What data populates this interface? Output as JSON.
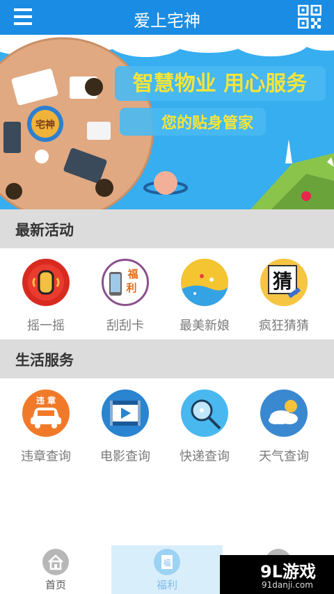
{
  "app": {
    "title": "爱上宅神"
  },
  "banner": {
    "headline": "智慧物业  用心服务",
    "subline": "您的贴身管家",
    "mascot": "宅神"
  },
  "sections": {
    "activities": {
      "title": "最新活动",
      "items": [
        {
          "label": "摇一摇",
          "icon": "shake-hand-icon"
        },
        {
          "label": "刮刮卡",
          "icon": "scratch-card-icon",
          "badge_top": "福",
          "badge_bottom": "利"
        },
        {
          "label": "最美新娘",
          "icon": "beach-icon"
        },
        {
          "label": "疯狂猜猜",
          "icon": "guess-icon",
          "badge": "猜"
        }
      ]
    },
    "services": {
      "title": "生活服务",
      "items": [
        {
          "label": "违章查询",
          "icon": "car-violation-icon",
          "badge": "违 章"
        },
        {
          "label": "电影查询",
          "icon": "film-icon"
        },
        {
          "label": "快递查询",
          "icon": "magnifier-icon"
        },
        {
          "label": "天气查询",
          "icon": "weather-icon"
        }
      ]
    }
  },
  "bottom_nav": {
    "tabs": [
      {
        "label": "首页",
        "icon": "home-icon"
      },
      {
        "label": "福利",
        "icon": "gift-icon",
        "glyph": "福"
      }
    ]
  },
  "watermark": {
    "main": "9L游戏",
    "sub": "91danji.com"
  },
  "colors": {
    "primary": "#1a8ce3",
    "banner_bg": "#36aef0",
    "section_bg": "#dcdcdc",
    "headline_text": "#f5e53a"
  }
}
